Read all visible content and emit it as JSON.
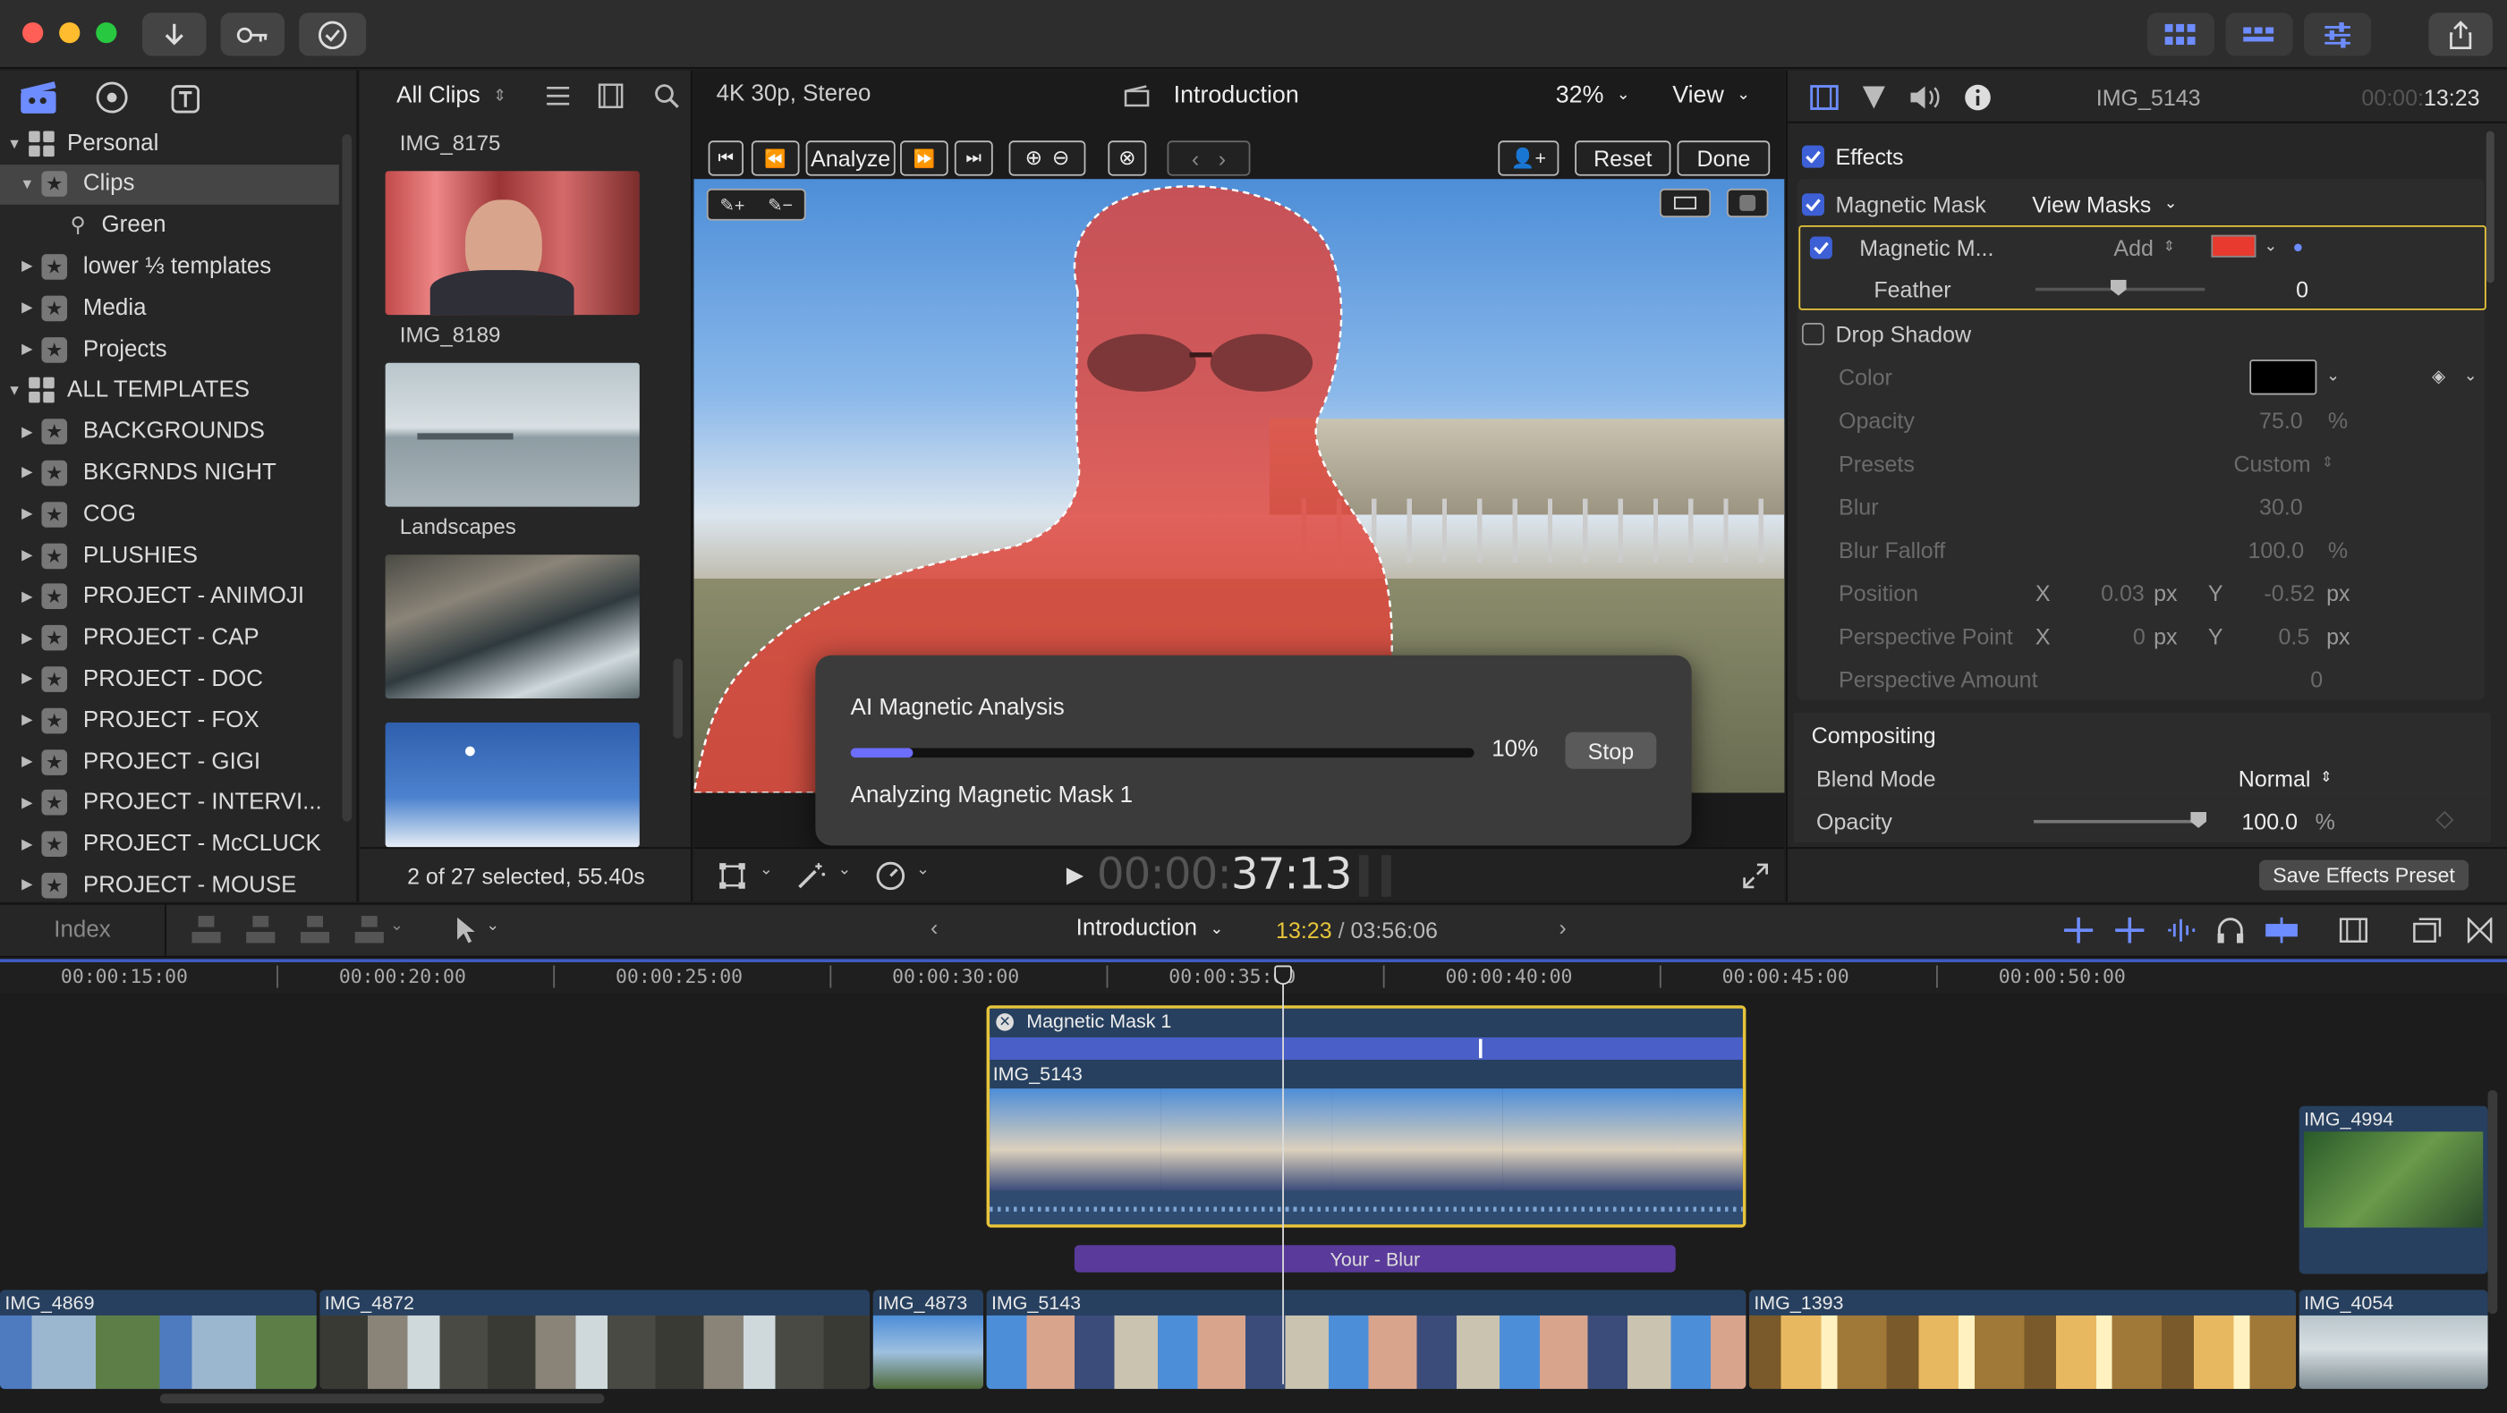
{
  "browser": {
    "filter_label": "All Clips",
    "clips": [
      {
        "name": "IMG_8175"
      },
      {
        "name": "IMG_8189"
      },
      {
        "name": "Landscapes"
      }
    ],
    "status": "2 of 27 selected, 55.40s"
  },
  "sidebar": {
    "items": [
      {
        "label": "Personal"
      },
      {
        "label": "Clips"
      },
      {
        "label": "Green"
      },
      {
        "label": "lower ⅓ templates"
      },
      {
        "label": "Media"
      },
      {
        "label": "Projects"
      },
      {
        "label": "ALL TEMPLATES"
      },
      {
        "label": "BACKGROUNDS"
      },
      {
        "label": "BKGRNDS NIGHT"
      },
      {
        "label": "COG"
      },
      {
        "label": "PLUSHIES"
      },
      {
        "label": "PROJECT - ANIMOJI"
      },
      {
        "label": "PROJECT - CAP"
      },
      {
        "label": "PROJECT - DOC"
      },
      {
        "label": "PROJECT - FOX"
      },
      {
        "label": "PROJECT - GIGI"
      },
      {
        "label": "PROJECT - INTERVI..."
      },
      {
        "label": "PROJECT - McCLUCK"
      },
      {
        "label": "PROJECT - MOUSE"
      }
    ]
  },
  "viewer": {
    "format": "4K 30p, Stereo",
    "title": "Introduction",
    "zoom": "32%",
    "view_label": "View",
    "analyze_label": "Analyze",
    "reset_label": "Reset",
    "done_label": "Done",
    "timecode_dim": "00:00:",
    "timecode": "37:13"
  },
  "analysis_dialog": {
    "title": "AI Magnetic Analysis",
    "progress": 0.1,
    "percent_label": "10%",
    "stop_label": "Stop",
    "status": "Analyzing Magnetic Mask 1"
  },
  "inspector": {
    "clip_name": "IMG_5143",
    "timecode_dim": "00:00:",
    "timecode": "13:23",
    "effects_label": "Effects",
    "magnetic_mask_label": "Magnetic Mask",
    "view_masks_label": "View Masks",
    "mask_row_label": "Magnetic M...",
    "mask_mode": "Add",
    "mask_color": "#e83a2e",
    "feather_label": "Feather",
    "feather_value": "0",
    "drop_shadow_label": "Drop Shadow",
    "params": {
      "color": "Color",
      "opacity": "Opacity",
      "opacity_value": "75.0",
      "presets": "Presets",
      "presets_value": "Custom",
      "blur": "Blur",
      "blur_value": "30.0",
      "blur_falloff": "Blur Falloff",
      "blur_falloff_value": "100.0",
      "position": "Position",
      "position_x": "0.03",
      "position_y": "-0.52",
      "perspective_point": "Perspective Point",
      "perspective_x": "0",
      "perspective_y": "0.5",
      "perspective_amount": "Perspective Amount",
      "perspective_amount_value": "0",
      "x_label": "X",
      "y_label": "Y",
      "px_unit": "px",
      "percent_unit": "%"
    },
    "compositing_label": "Compositing",
    "blend_mode_label": "Blend Mode",
    "blend_mode_value": "Normal",
    "comp_opacity_label": "Opacity",
    "comp_opacity_value": "100.0",
    "comp_opacity_unit": "%",
    "save_preset_label": "Save Effects Preset"
  },
  "timeline": {
    "index_label": "Index",
    "project_name": "Introduction",
    "position": "13:23",
    "duration": "03:56:06",
    "ruler": [
      "00:00:15:00",
      "00:00:20:00",
      "00:00:25:00",
      "00:00:30:00",
      "00:00:35:00",
      "00:00:40:00",
      "00:00:45:00",
      "00:00:50:00"
    ],
    "mask_clip": "Magnetic Mask 1",
    "selected_clip": "IMG_5143",
    "title_clip": "Your - Blur",
    "connected_clip": "IMG_4994",
    "primary_clips": [
      "IMG_4869",
      "IMG_4872",
      "IMG_4873",
      "IMG_5143",
      "IMG_1393",
      "IMG_4054"
    ]
  },
  "colors": {
    "accent": "#3e60d6",
    "selection": "#e8c53a",
    "mask_overlay": "#e0443a",
    "title_clip": "#5a3a9a"
  }
}
